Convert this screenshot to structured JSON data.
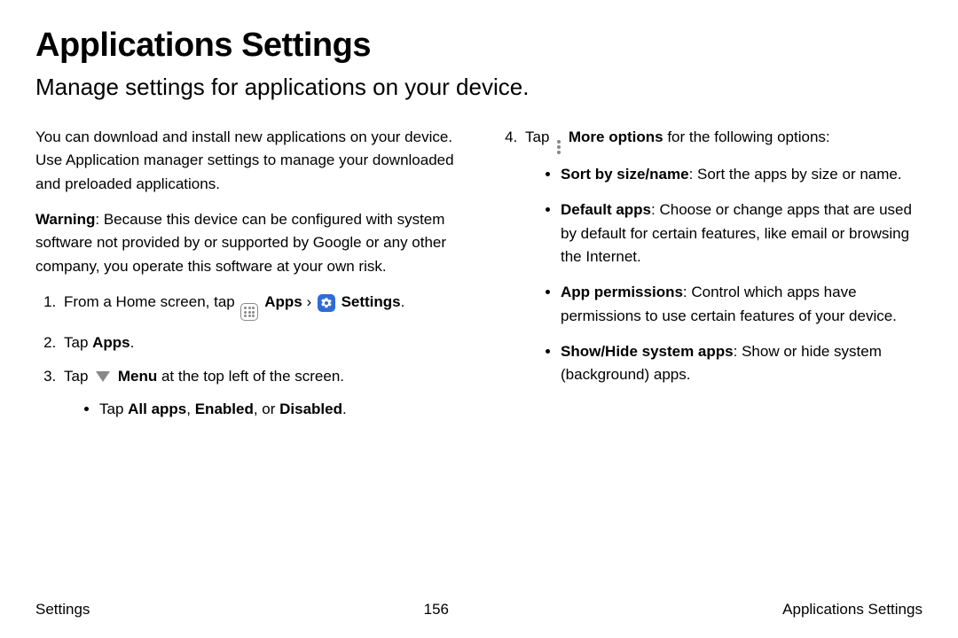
{
  "title": "Applications Settings",
  "subtitle": "Manage settings for applications on your device.",
  "intro": "You can download and install new applications on your device. Use Application manager settings to manage your downloaded and preloaded applications.",
  "warning_label": "Warning",
  "warning_text": ": Because this device can be configured with system software not provided by or supported by Google or any other company, you operate this software at your own risk.",
  "step1_prefix": "From a Home screen, tap ",
  "step1_apps": " Apps",
  "step1_sep": " › ",
  "step1_settings": " Settings",
  "step1_end": ".",
  "step2_prefix": "Tap ",
  "step2_bold": "Apps",
  "step2_end": ".",
  "step3_prefix": "Tap ",
  "step3_bold": " Menu",
  "step3_suffix": " at the top left of the screen.",
  "step3_sub_prefix": "Tap ",
  "step3_sub_b1": "All apps",
  "step3_sub_s1": ", ",
  "step3_sub_b2": "Enabled",
  "step3_sub_s2": ", or ",
  "step3_sub_b3": "Disabled",
  "step3_sub_end": ".",
  "step4_prefix": "Tap ",
  "step4_bold": " More options",
  "step4_suffix": " for the following options:",
  "opt1_b": "Sort by size/name",
  "opt1_t": ": Sort the apps by size or name.",
  "opt2_b": "Default apps",
  "opt2_t": ": Choose or change apps that are used by default for certain features, like email or browsing the Internet.",
  "opt3_b": "App permissions",
  "opt3_t": ": Control which apps have permissions to use certain features of your device.",
  "opt4_b": "Show/Hide system apps",
  "opt4_t": ": Show or hide system (background) apps.",
  "footer_left": "Settings",
  "footer_center": "156",
  "footer_right": "Applications Settings"
}
